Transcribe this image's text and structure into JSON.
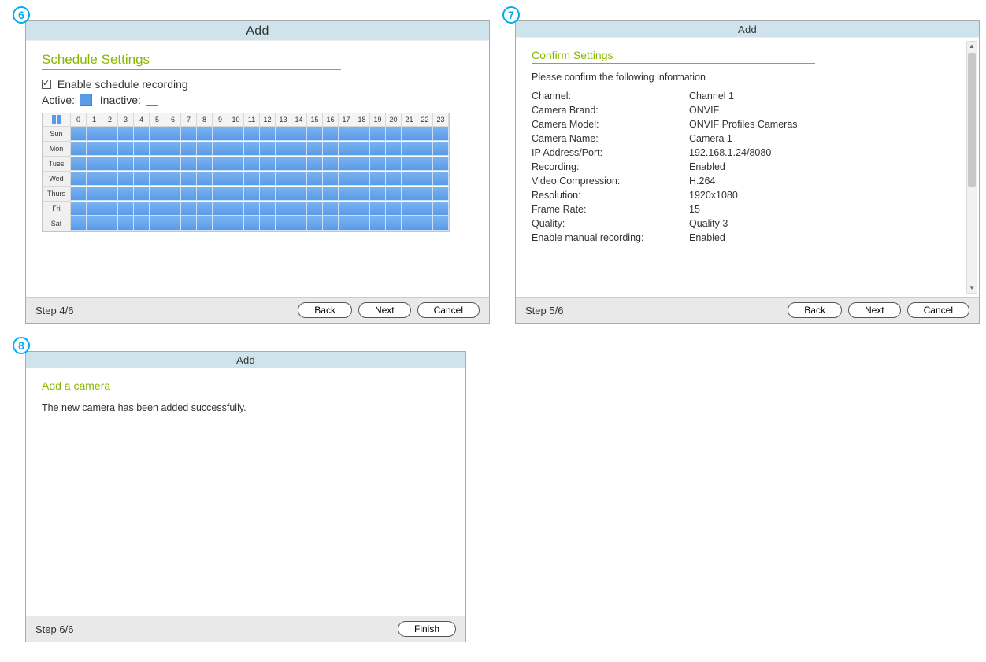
{
  "badges": {
    "p6": "6",
    "p7": "7",
    "p8": "8"
  },
  "panel6": {
    "title": "Add",
    "heading": "Schedule Settings",
    "enable_label": "Enable schedule recording",
    "enable_checked": true,
    "active_label": "Active:",
    "inactive_label": "Inactive:",
    "hours": [
      "0",
      "1",
      "2",
      "3",
      "4",
      "5",
      "6",
      "7",
      "8",
      "9",
      "10",
      "11",
      "12",
      "13",
      "14",
      "15",
      "16",
      "17",
      "18",
      "19",
      "20",
      "21",
      "22",
      "23"
    ],
    "days": [
      "Sun",
      "Mon",
      "Tues",
      "Wed",
      "Thurs",
      "Fri",
      "Sat"
    ],
    "step": "Step 4/6",
    "buttons": {
      "back": "Back",
      "next": "Next",
      "cancel": "Cancel"
    }
  },
  "panel7": {
    "title": "Add",
    "heading": "Confirm Settings",
    "info": "Please confirm the following information",
    "rows": [
      {
        "k": "Channel:",
        "v": "Channel 1"
      },
      {
        "k": "Camera Brand:",
        "v": "ONVIF"
      },
      {
        "k": "Camera Model:",
        "v": "ONVIF Profiles Cameras"
      },
      {
        "k": "Camera Name:",
        "v": "Camera 1"
      },
      {
        "k": "IP Address/Port:",
        "v": "192.168.1.24/8080"
      },
      {
        "k": "Recording:",
        "v": "Enabled"
      },
      {
        "k": "Video Compression:",
        "v": "H.264"
      },
      {
        "k": "Resolution:",
        "v": "1920x1080"
      },
      {
        "k": "Frame Rate:",
        "v": "15"
      },
      {
        "k": "Quality:",
        "v": "Quality 3"
      },
      {
        "k": "Enable manual recording:",
        "v": "Enabled"
      }
    ],
    "step": "Step 5/6",
    "buttons": {
      "back": "Back",
      "next": "Next",
      "cancel": "Cancel"
    }
  },
  "panel8": {
    "title": "Add",
    "heading": "Add a camera",
    "info": "The new camera has been added successfully.",
    "step": "Step 6/6",
    "buttons": {
      "finish": "Finish"
    }
  }
}
